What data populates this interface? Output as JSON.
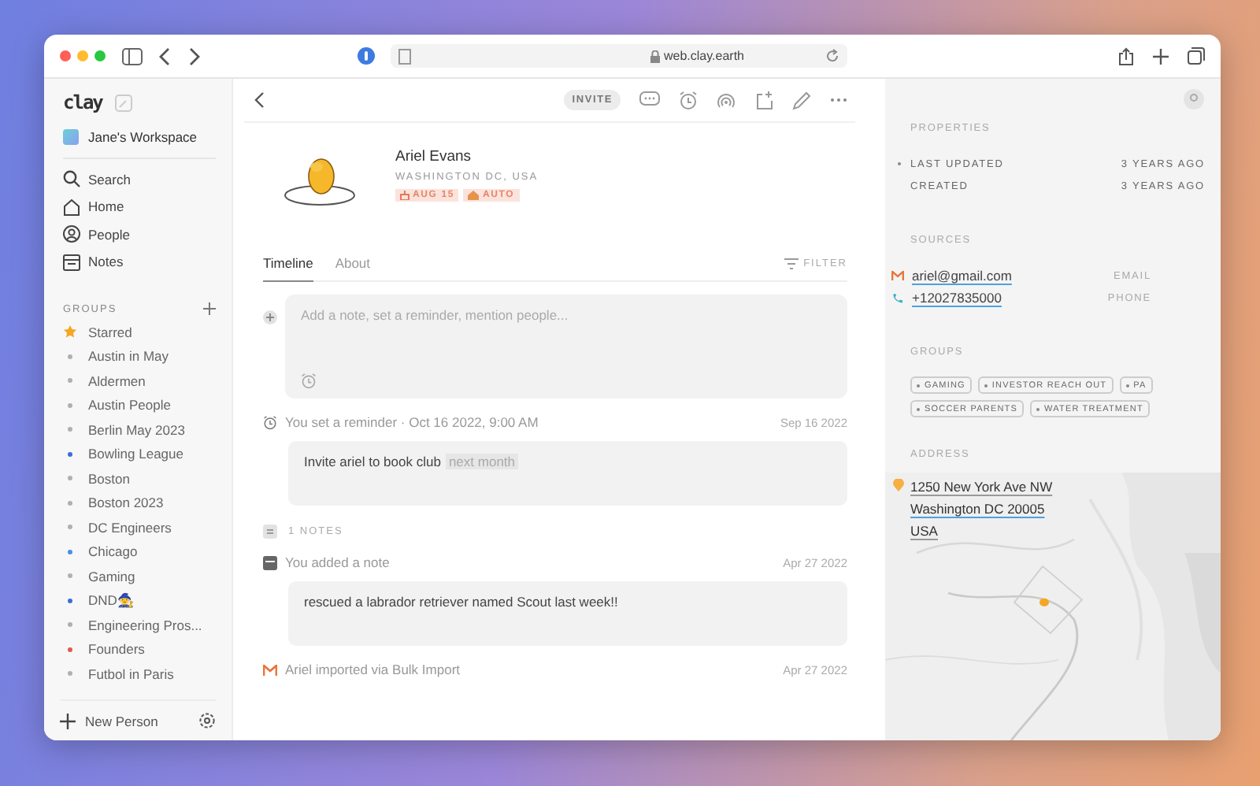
{
  "browser": {
    "url": "web.clay.earth"
  },
  "sidebar": {
    "logo": "clay",
    "workspace": "Jane's Workspace",
    "nav": [
      {
        "label": "Search",
        "kind": "search"
      },
      {
        "label": "Home",
        "kind": "home"
      },
      {
        "label": "People",
        "kind": "people"
      },
      {
        "label": "Notes",
        "kind": "notes"
      }
    ],
    "groups_heading": "GROUPS",
    "groups": [
      {
        "label": "Starred",
        "kind": "star",
        "color": "#f5a623"
      },
      {
        "label": "Austin in May",
        "kind": "dot",
        "color": "#b0b0b0"
      },
      {
        "label": "Aldermen",
        "kind": "dot",
        "color": "#b0b0b0"
      },
      {
        "label": "Austin People",
        "kind": "dot",
        "color": "#b0b0b0"
      },
      {
        "label": "Berlin May 2023",
        "kind": "dot",
        "color": "#b0b0b0"
      },
      {
        "label": "Bowling League",
        "kind": "dot",
        "color": "#3a6fd8"
      },
      {
        "label": "Boston",
        "kind": "dot",
        "color": "#b0b0b0"
      },
      {
        "label": "Boston 2023",
        "kind": "dot",
        "color": "#b0b0b0"
      },
      {
        "label": "DC Engineers",
        "kind": "dot",
        "color": "#b0b0b0"
      },
      {
        "label": "Chicago",
        "kind": "dot",
        "color": "#4a90e2"
      },
      {
        "label": "Gaming",
        "kind": "dot",
        "color": "#b0b0b0"
      },
      {
        "label": "DND",
        "kind": "dot",
        "color": "#3a6fd8",
        "emoji": "🧙"
      },
      {
        "label": "Engineering Pros...",
        "kind": "dot",
        "color": "#b0b0b0"
      },
      {
        "label": "Founders",
        "kind": "dot",
        "color": "#e05a4a"
      },
      {
        "label": "Futbol in Paris",
        "kind": "dot",
        "color": "#b0b0b0"
      }
    ],
    "footer": "New Person"
  },
  "header": {
    "invite": "INVITE"
  },
  "profile": {
    "name": "Ariel Evans",
    "location": "WASHINGTON DC, USA",
    "tags": [
      {
        "label": "AUG 15",
        "kind": "birthday"
      },
      {
        "label": "AUTO",
        "kind": "auto"
      }
    ]
  },
  "tabs": [
    {
      "label": "Timeline",
      "selected": true
    },
    {
      "label": "About",
      "selected": false
    }
  ],
  "filter": "FILTER",
  "composer": {
    "placeholder": "Add a note, set a reminder, mention people..."
  },
  "timeline": [
    {
      "kind": "reminder",
      "text": "You set a reminder · Oct 16 2022, 9:00 AM",
      "date": "Sep 16 2022",
      "body": "Invite ariel to book club",
      "chip": "next month"
    },
    {
      "kind": "count",
      "text": "1 NOTES"
    },
    {
      "kind": "note",
      "text": "You added a note",
      "date": "Apr 27 2022",
      "body": "rescued a labrador retriever named Scout last week!!"
    },
    {
      "kind": "import",
      "text": "Ariel imported via Bulk Import",
      "date": "Apr 27 2022"
    }
  ],
  "panel": {
    "properties_heading": "PROPERTIES",
    "properties": [
      {
        "label": "LAST UPDATED",
        "value": "3 YEARS AGO",
        "highlighted": true
      },
      {
        "label": "CREATED",
        "value": "3 YEARS AGO",
        "highlighted": false
      }
    ],
    "sources_heading": "SOURCES",
    "sources": [
      {
        "value": "ariel@gmail.com",
        "label": "EMAIL",
        "kind": "email"
      },
      {
        "value": "+12027835000",
        "label": "PHONE",
        "kind": "phone"
      }
    ],
    "groups_heading": "GROUPS",
    "groups": [
      "GAMING",
      "INVESTOR REACH OUT",
      "PA",
      "SOCCER PARENTS",
      "WATER TREATMENT"
    ],
    "address_heading": "ADDRESS",
    "address": [
      "1250 New York Ave NW",
      "Washington DC 20005",
      "USA"
    ]
  }
}
